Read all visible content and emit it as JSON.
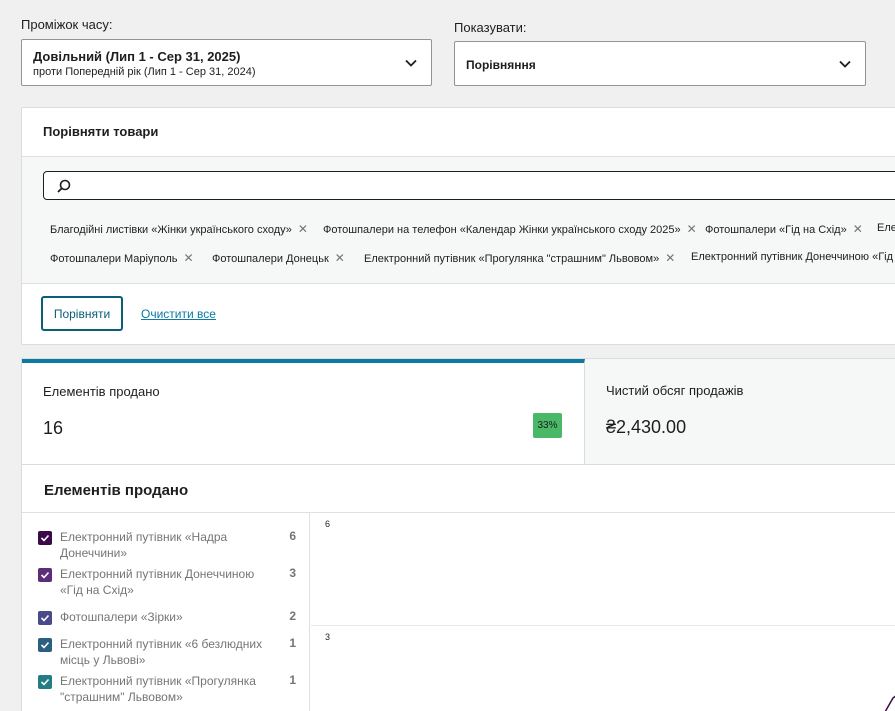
{
  "filters": {
    "range_label": "Проміжок часу:",
    "range_main": "Довільний (Лип 1 - Сер 31, 2025)",
    "range_sub": "проти Попередній рік (Лип 1 - Сер 31, 2024)",
    "show_label": "Показувати:",
    "show_value": "Порівняння"
  },
  "compare": {
    "title": "Порівняти товари",
    "search_placeholder": "",
    "chips": [
      "Благодійні листівки «Жінки українського сходу»",
      "Фотошпалери на телефон «Календар Жінки українського сходу 2025»",
      "Фотошпалери «Гід на Схід»",
      "Еле",
      "Фотошпалери Маріуполь",
      "Фотошпалери Донецьк",
      "Електронний путівник «Прогулянка \"страшним\" Львовом»",
      "Електронний путівник Донеччиною «Гід н"
    ],
    "compare_button": "Порівняти",
    "clear_link": "Очистити все"
  },
  "stats": {
    "items_sold_label": "Елементів продано",
    "items_sold_value": "16",
    "items_sold_delta": "33%",
    "net_sales_label": "Чистий обсяг продажів",
    "net_sales_value": "₴2,430.00"
  },
  "chart": {
    "title": "Елементів продано",
    "legend": [
      {
        "label": "Електронний путівник «Надра Донеччини»",
        "count": "6",
        "color": "#3c0a49"
      },
      {
        "label": "Електронний путівник Донеччиною «Гід на Схід»",
        "count": "3",
        "color": "#5d2d7a"
      },
      {
        "label": "Фотошпалери «Зірки»",
        "count": "2",
        "color": "#4a4a8a"
      },
      {
        "label": "Електронний путівник «6 безлюдних місць у Львові»",
        "count": "1",
        "color": "#2b5f82"
      },
      {
        "label": "Електронний путівник «Прогулянка \"страшним\" Львовом»",
        "count": "1",
        "color": "#237d85"
      }
    ]
  },
  "chart_data": {
    "type": "line",
    "title": "Елементів продано",
    "xlabel": "",
    "ylabel": "",
    "y_ticks": [
      "6",
      "3"
    ],
    "ylim": [
      0,
      6
    ],
    "series": [
      {
        "name": "Електронний путівник «Надра Донеччини»",
        "total": 6
      },
      {
        "name": "Електронний путівник Донеччиною «Гід на Схід»",
        "total": 3
      },
      {
        "name": "Фотошпалери «Зірки»",
        "total": 2
      },
      {
        "name": "Електронний путівник «6 безлюдних місць у Львові»",
        "total": 1
      },
      {
        "name": "Електронний путівник «Прогулянка \"страшним\" Львовом»",
        "total": 1
      }
    ]
  }
}
